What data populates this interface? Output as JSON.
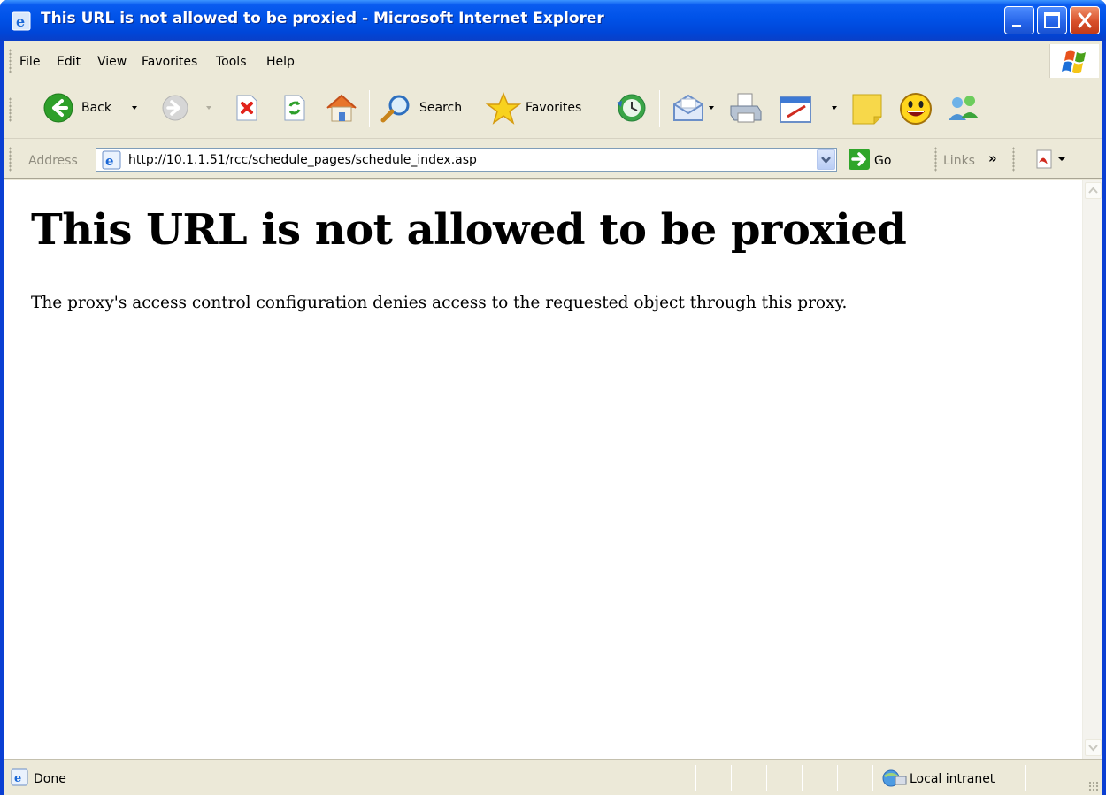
{
  "window": {
    "title": "This URL is not allowed to be proxied - Microsoft Internet Explorer"
  },
  "menu": {
    "items": [
      "File",
      "Edit",
      "View",
      "Favorites",
      "Tools",
      "Help"
    ]
  },
  "toolbar": {
    "back_label": "Back",
    "search_label": "Search",
    "favorites_label": "Favorites"
  },
  "address": {
    "label": "Address",
    "url": "http://10.1.1.51/rcc/schedule_pages/schedule_index.asp",
    "go_label": "Go",
    "links_label": "Links",
    "links_more": "»"
  },
  "page": {
    "heading": "This URL is not allowed to be proxied",
    "message": "The proxy's access control configuration denies access to the requested object through this proxy."
  },
  "status": {
    "text": "Done",
    "zone": "Local intranet"
  },
  "colors": {
    "titlebar": "#0052e8",
    "chrome": "#ece9d8",
    "close_button": "#d8502a"
  }
}
